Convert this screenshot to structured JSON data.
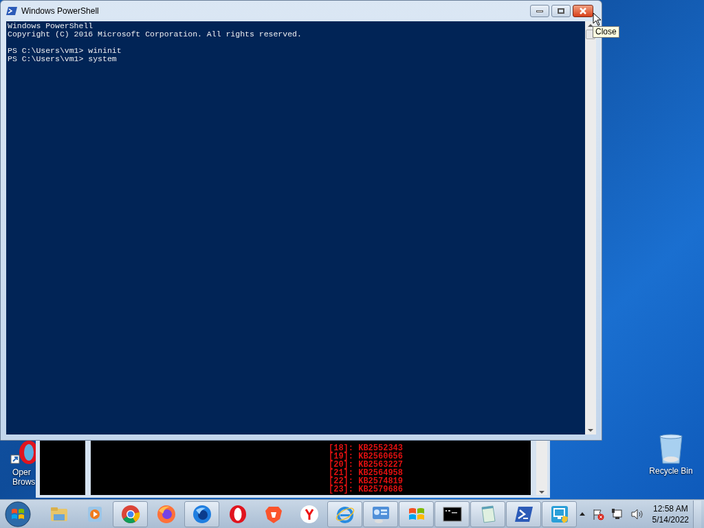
{
  "window": {
    "title": "Windows PowerShell",
    "console_blocks": [
      [
        "Windows PowerShell",
        "Copyright (C) 2016 Microsoft Corporation. All rights reserved."
      ],
      [
        "PS C:\\Users\\vm1> wininit",
        "PS C:\\Users\\vm1> system"
      ]
    ],
    "tooltip": "Close"
  },
  "background_console": {
    "lines": [
      "[18]: KB2552343",
      "[19]: KB2560656",
      "[20]: KB2563227",
      "[21]: KB2564958",
      "[22]: KB2574819",
      "[23]: KB2579686"
    ]
  },
  "desktop_icons": [
    {
      "kind": "browser",
      "label_lines": [
        "Oper",
        "Brows"
      ]
    },
    {
      "kind": "recycle",
      "label_lines": [
        "Recycle Bin"
      ]
    }
  ],
  "taskbar": {
    "items": [
      {
        "kind": "folder",
        "running": false
      },
      {
        "kind": "media",
        "running": false
      },
      {
        "kind": "chrome",
        "running": true
      },
      {
        "kind": "firefox",
        "running": false
      },
      {
        "kind": "bluefox",
        "running": true
      },
      {
        "kind": "opera",
        "running": false
      },
      {
        "kind": "brave",
        "running": false
      },
      {
        "kind": "yandex",
        "running": false
      },
      {
        "kind": "ie",
        "running": true
      },
      {
        "kind": "panel",
        "running": true
      },
      {
        "kind": "winflag",
        "running": true
      },
      {
        "kind": "cmd",
        "running": true
      },
      {
        "kind": "notepad",
        "running": true
      },
      {
        "kind": "powershell",
        "running": true
      },
      {
        "kind": "remote",
        "running": true
      }
    ],
    "clock": {
      "time": "12:58 AM",
      "date": "5/14/2022"
    }
  }
}
